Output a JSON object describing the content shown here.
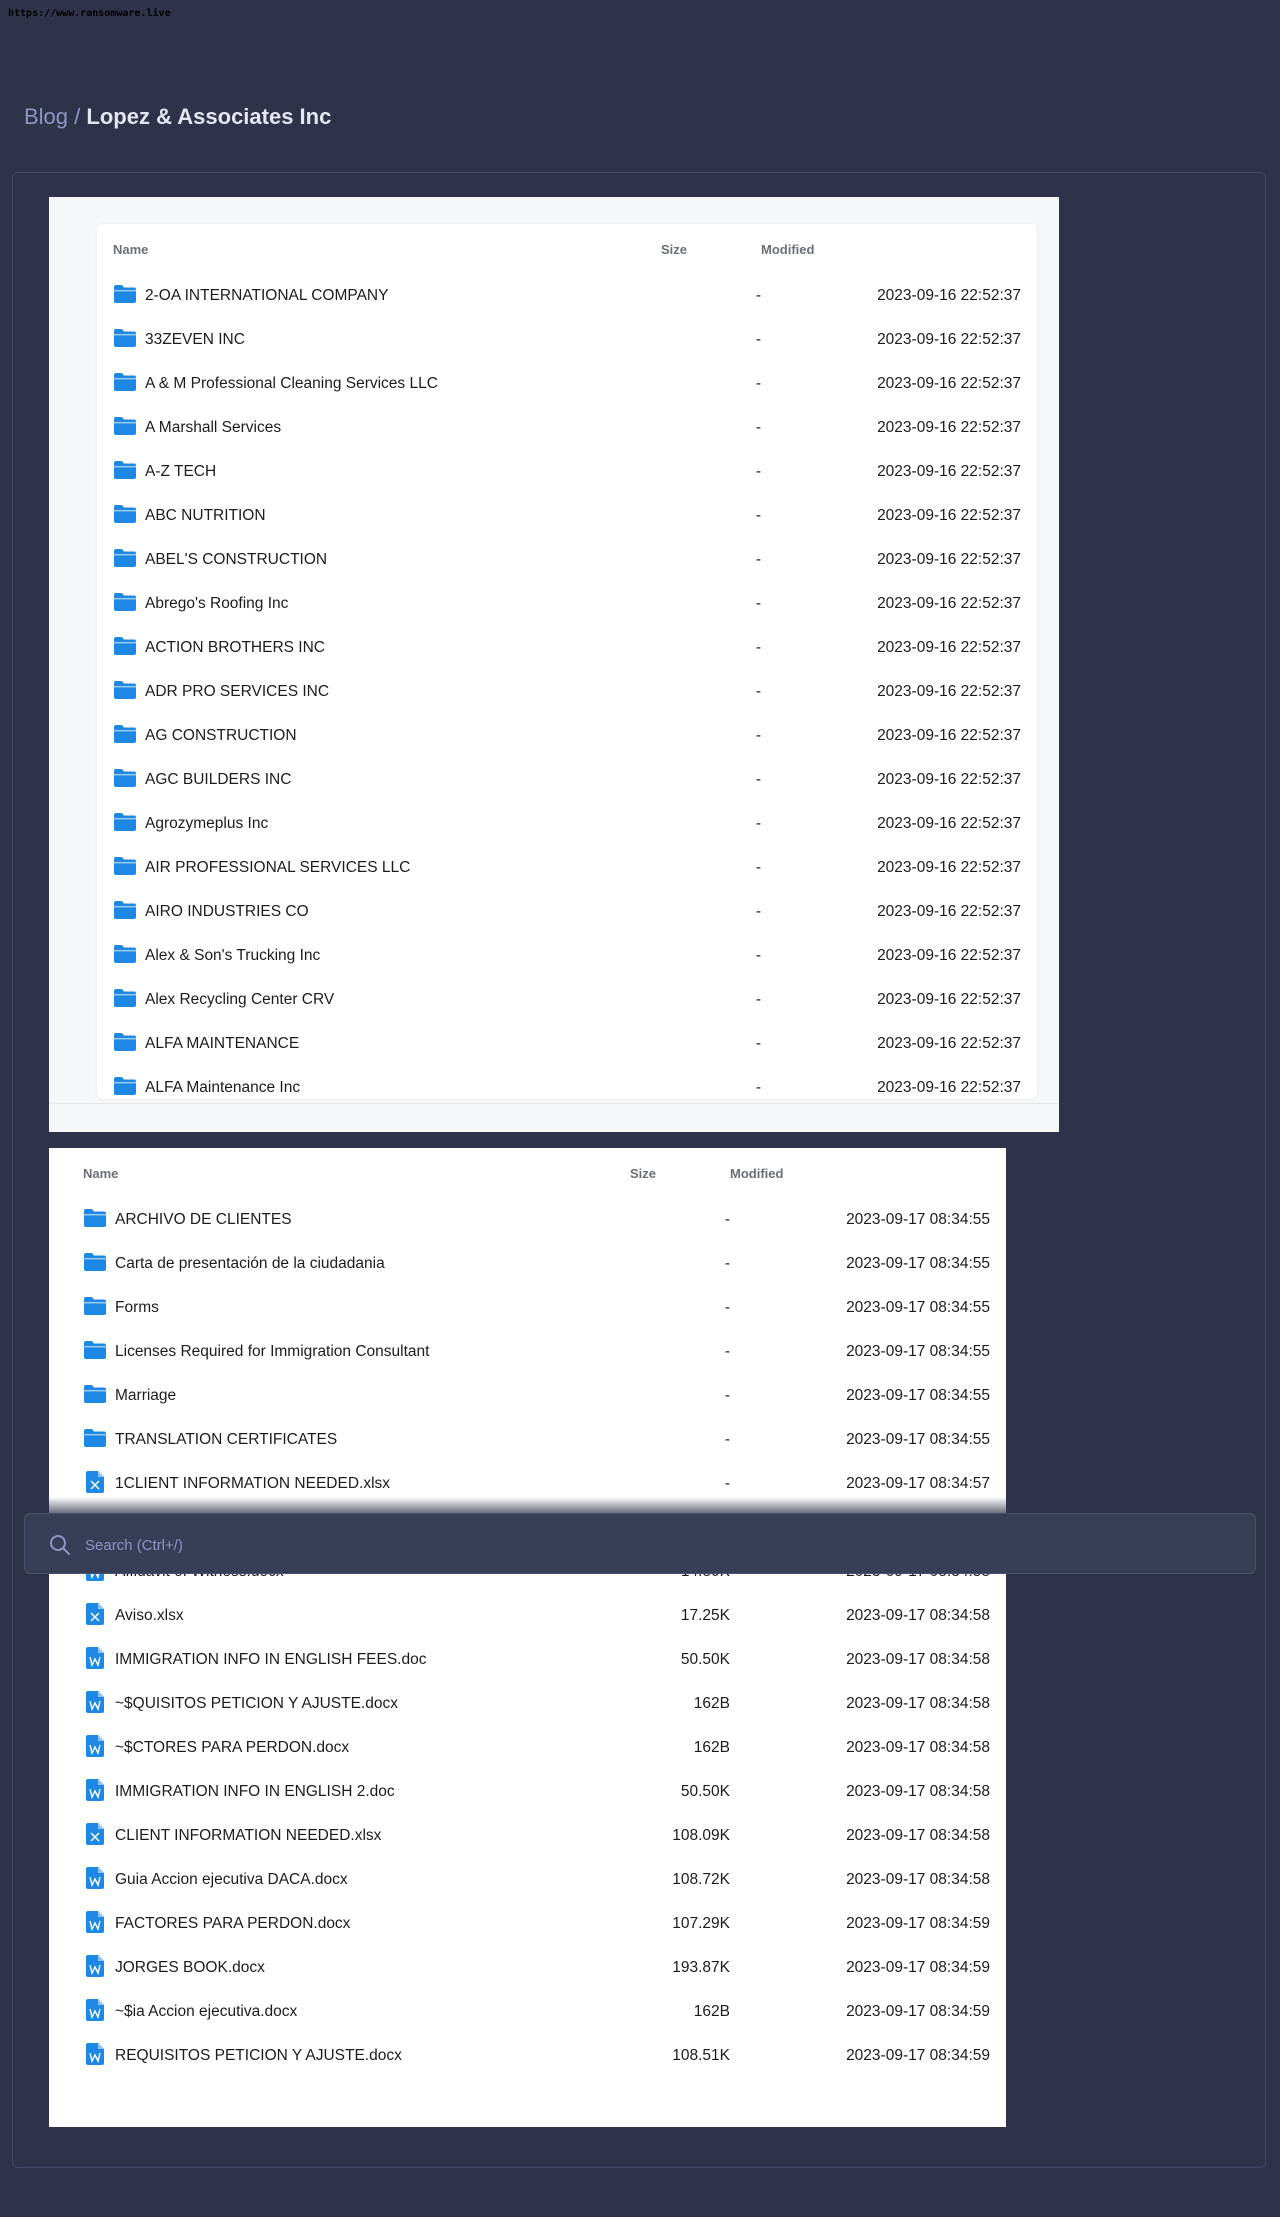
{
  "page": {
    "url": "https://www.ransomware.live",
    "breadcrumb": {
      "blog": "Blog",
      "separator": "/",
      "current": "Lopez & Associates Inc"
    }
  },
  "columns": {
    "name": "Name",
    "size": "Size",
    "modified": "Modified"
  },
  "listing1": [
    {
      "type": "folder",
      "name": "2-OA INTERNATIONAL COMPANY",
      "size": "-",
      "modified": "2023-09-16 22:52:37"
    },
    {
      "type": "folder",
      "name": "33ZEVEN INC",
      "size": "-",
      "modified": "2023-09-16 22:52:37"
    },
    {
      "type": "folder",
      "name": "A & M Professional Cleaning Services LLC",
      "size": "-",
      "modified": "2023-09-16 22:52:37"
    },
    {
      "type": "folder",
      "name": "A Marshall Services",
      "size": "-",
      "modified": "2023-09-16 22:52:37"
    },
    {
      "type": "folder",
      "name": "A-Z TECH",
      "size": "-",
      "modified": "2023-09-16 22:52:37"
    },
    {
      "type": "folder",
      "name": "ABC NUTRITION",
      "size": "-",
      "modified": "2023-09-16 22:52:37"
    },
    {
      "type": "folder",
      "name": "ABEL'S CONSTRUCTION",
      "size": "-",
      "modified": "2023-09-16 22:52:37"
    },
    {
      "type": "folder",
      "name": "Abrego's Roofing Inc",
      "size": "-",
      "modified": "2023-09-16 22:52:37"
    },
    {
      "type": "folder",
      "name": "ACTION BROTHERS INC",
      "size": "-",
      "modified": "2023-09-16 22:52:37"
    },
    {
      "type": "folder",
      "name": "ADR PRO SERVICES INC",
      "size": "-",
      "modified": "2023-09-16 22:52:37"
    },
    {
      "type": "folder",
      "name": "AG CONSTRUCTION",
      "size": "-",
      "modified": "2023-09-16 22:52:37"
    },
    {
      "type": "folder",
      "name": "AGC BUILDERS INC",
      "size": "-",
      "modified": "2023-09-16 22:52:37"
    },
    {
      "type": "folder",
      "name": "Agrozymeplus Inc",
      "size": "-",
      "modified": "2023-09-16 22:52:37"
    },
    {
      "type": "folder",
      "name": "AIR PROFESSIONAL SERVICES LLC",
      "size": "-",
      "modified": "2023-09-16 22:52:37"
    },
    {
      "type": "folder",
      "name": "AIRO INDUSTRIES CO",
      "size": "-",
      "modified": "2023-09-16 22:52:37"
    },
    {
      "type": "folder",
      "name": "Alex & Son's Trucking Inc",
      "size": "-",
      "modified": "2023-09-16 22:52:37"
    },
    {
      "type": "folder",
      "name": "Alex Recycling Center CRV",
      "size": "-",
      "modified": "2023-09-16 22:52:37"
    },
    {
      "type": "folder",
      "name": "ALFA MAINTENANCE",
      "size": "-",
      "modified": "2023-09-16 22:52:37"
    },
    {
      "type": "folder",
      "name": "ALFA Maintenance Inc",
      "size": "-",
      "modified": "2023-09-16 22:52:37"
    }
  ],
  "listing2": [
    {
      "type": "folder",
      "name": "ARCHIVO DE CLIENTES",
      "size": "-",
      "modified": "2023-09-17 08:34:55"
    },
    {
      "type": "folder",
      "name": "Carta de presentación de la ciudadania",
      "size": "-",
      "modified": "2023-09-17 08:34:55"
    },
    {
      "type": "folder",
      "name": "Forms",
      "size": "-",
      "modified": "2023-09-17 08:34:55"
    },
    {
      "type": "folder",
      "name": "Licenses Required for Immigration Consultant",
      "size": "-",
      "modified": "2023-09-17 08:34:55"
    },
    {
      "type": "folder",
      "name": "Marriage",
      "size": "-",
      "modified": "2023-09-17 08:34:55"
    },
    {
      "type": "folder",
      "name": "TRANSLATION CERTIFICATES",
      "size": "-",
      "modified": "2023-09-17 08:34:55"
    },
    {
      "type": "xlsx",
      "name": "1CLIENT INFORMATION NEEDED.xlsx",
      "size": "-",
      "modified": "2023-09-17 08:34:57"
    },
    {
      "type": "docx",
      "name": "",
      "size": "",
      "modified": ""
    },
    {
      "type": "docx",
      "name": "Affidavit of Witness.docx",
      "size": "14.80K",
      "modified": "2023-09-17 08:34:58"
    },
    {
      "type": "xlsx",
      "name": "Aviso.xlsx",
      "size": "17.25K",
      "modified": "2023-09-17 08:34:58"
    },
    {
      "type": "docx",
      "name": "IMMIGRATION INFO IN ENGLISH FEES.doc",
      "size": "50.50K",
      "modified": "2023-09-17 08:34:58"
    },
    {
      "type": "docx",
      "name": "~$QUISITOS PETICION Y AJUSTE.docx",
      "size": "162B",
      "modified": "2023-09-17 08:34:58"
    },
    {
      "type": "docx",
      "name": "~$CTORES PARA PERDON.docx",
      "size": "162B",
      "modified": "2023-09-17 08:34:58"
    },
    {
      "type": "docx",
      "name": "IMMIGRATION INFO IN ENGLISH 2.doc",
      "size": "50.50K",
      "modified": "2023-09-17 08:34:58"
    },
    {
      "type": "xlsx",
      "name": "CLIENT INFORMATION NEEDED.xlsx",
      "size": "108.09K",
      "modified": "2023-09-17 08:34:58"
    },
    {
      "type": "docx",
      "name": "Guia Accion ejecutiva DACA.docx",
      "size": "108.72K",
      "modified": "2023-09-17 08:34:58"
    },
    {
      "type": "docx",
      "name": "FACTORES PARA PERDON.docx",
      "size": "107.29K",
      "modified": "2023-09-17 08:34:59"
    },
    {
      "type": "docx",
      "name": "JORGES BOOK.docx",
      "size": "193.87K",
      "modified": "2023-09-17 08:34:59"
    },
    {
      "type": "docx",
      "name": "~$ia Accion ejecutiva.docx",
      "size": "162B",
      "modified": "2023-09-17 08:34:59"
    },
    {
      "type": "docx",
      "name": "REQUISITOS PETICION Y AJUSTE.docx",
      "size": "108.51K",
      "modified": "2023-09-17 08:34:59"
    }
  ],
  "search": {
    "placeholder": "Search (Ctrl+/)"
  },
  "colors": {
    "folder": "#1e88e5",
    "background": "#2f3349",
    "accent": "#8f96c4"
  }
}
